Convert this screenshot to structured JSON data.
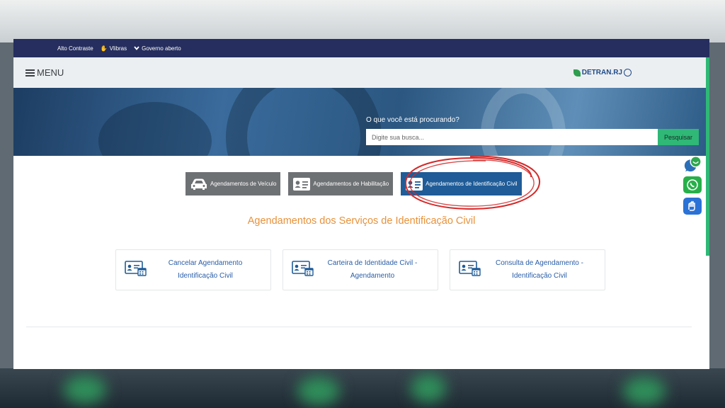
{
  "gov_bar": {
    "items": [
      {
        "label": "Alto Contraste",
        "icon": ""
      },
      {
        "label": "Vlibras",
        "icon": "hands-icon"
      },
      {
        "label": "Governo aberto",
        "icon": "chevron-down-icon"
      }
    ]
  },
  "header": {
    "menu_label": "MENU",
    "logo_text": "DETRAN.RJ"
  },
  "hero": {
    "search_label": "O que você está procurando?",
    "search_placeholder": "Digite sua busca...",
    "search_button": "Pesquisar"
  },
  "tabs": [
    {
      "label": "Agendamentos de Veículo",
      "icon": "car-icon",
      "active": false
    },
    {
      "label": "Agendamentos de Habilitação",
      "icon": "id-card-icon",
      "active": false
    },
    {
      "label": "Agendamentos de Identificação Civil",
      "icon": "id-card-icon",
      "active": true
    }
  ],
  "section_title": "Agendamentos dos Serviços de Identificação Civil",
  "cards": [
    {
      "line1": "Cancelar Agendamento",
      "line2": "Identificação Civil",
      "icon": "id-card-calendar-icon"
    },
    {
      "line1": "Carteira de Identidade Civil -",
      "line2": "Agendamento",
      "icon": "id-card-calendar-icon"
    },
    {
      "line1": "Consulta de Agendamento -",
      "line2": "Identificação Civil",
      "icon": "id-card-calendar-icon"
    }
  ],
  "floating_buttons": [
    "chat-icon",
    "whatsapp-icon",
    "sign-language-icon"
  ],
  "colors": {
    "gov_bar": "#252e5e",
    "accent_green": "#2fb876",
    "tab_active": "#1f5c98",
    "tab_inactive": "#6e7174",
    "section_title": "#e8913a",
    "card_text": "#2a5ea8",
    "annotation_red": "#d42a2a"
  }
}
